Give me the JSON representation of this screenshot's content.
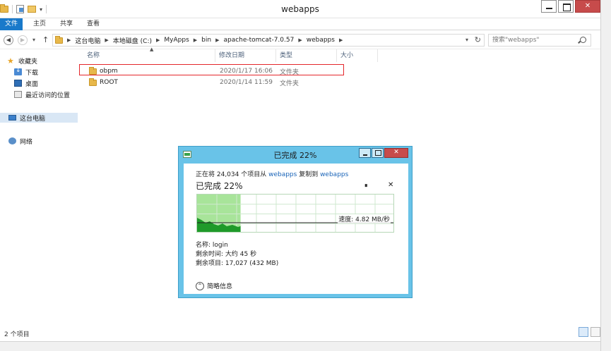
{
  "window": {
    "title": "webapps",
    "quick_access_dropdown": "▾"
  },
  "ribbon": {
    "tabs": [
      "文件",
      "主页",
      "共享",
      "查看"
    ]
  },
  "address": {
    "crumbs": [
      "这台电脑",
      "本地磁盘 (C:)",
      "MyApps",
      "bin",
      "apache-tomcat-7.0.57",
      "webapps"
    ],
    "search_placeholder": "搜索\"webapps\""
  },
  "navpane": {
    "favorites_label": "收藏夹",
    "favorites": [
      "下载",
      "桌面",
      "最近访问的位置"
    ],
    "this_pc": "这台电脑",
    "network": "网络"
  },
  "columns": [
    "名称",
    "修改日期",
    "类型",
    "大小"
  ],
  "files": [
    {
      "name": "obpm",
      "date": "2020/1/17 16:06",
      "type": "文件夹",
      "highlighted": true
    },
    {
      "name": "ROOT",
      "date": "2020/1/14 11:59",
      "type": "文件夹",
      "highlighted": false
    }
  ],
  "status": {
    "item_count": "2 个项目"
  },
  "dialog": {
    "title": "已完成 22%",
    "copy_prefix": "正在将 24,034 个项目从 ",
    "source": "webapps",
    "copy_middle": " 复制到 ",
    "destination": "webapps",
    "percent_text": "已完成 22%",
    "progress_fraction": 0.22,
    "pause_symbol": "⏸",
    "cancel_symbol": "✕",
    "speed": "速度: 4.82 MB/秒",
    "name_line": "名称: login",
    "time_line": "剩余时间: 大约 45 秒",
    "items_line": "剩余项目: 17,027 (432 MB)",
    "less_details": "简略信息",
    "colors": {
      "frame": "#69c3e8",
      "progress_fill": "#a8e49a",
      "throughput": "#1f9a2a"
    }
  }
}
